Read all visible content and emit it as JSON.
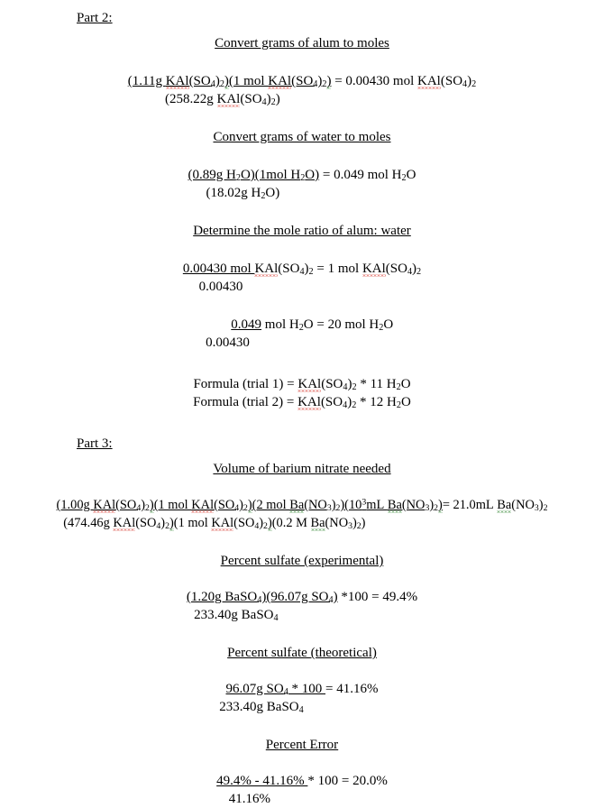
{
  "document": {
    "type": "chemistry-lab-calculations",
    "parts": [
      {
        "label": "Part 2:",
        "sections": [
          {
            "heading": "Convert grams of alum to moles",
            "numerator": "(1.11g KAl(SO4)2)(1 mol KAl(SO4)2)",
            "result": " = 0.00430 mol KAl(SO4)2",
            "denominator": "(258.22g KAl(SO4)2)"
          },
          {
            "heading": "Convert grams of water to moles",
            "numerator": "(0.89g H2O)(1mol H2O)",
            "result": " = 0.049 mol H2O",
            "denominator": "(18.02g H2O)"
          },
          {
            "heading": "Determine the mole ratio of alum: water",
            "numerator": "0.00430 mol ",
            "result": "KAl(SO4)2 = 1 mol KAl(SO4)2",
            "denominator": "0.00430"
          },
          {
            "heading": "",
            "numerator": "0.049",
            "result": " mol H2O = 20 mol H2O",
            "denominator": "0.00430"
          }
        ],
        "formulas": [
          {
            "label": "Formula (trial 1) = ",
            "value": "KAl(SO4)2 * 11 H2O"
          },
          {
            "label": "Formula (trial 2) = ",
            "value": "KAl(SO4)2 * 12 H2O"
          }
        ]
      },
      {
        "label": "Part 3:",
        "sections": [
          {
            "heading": "Volume of barium nitrate needed",
            "numerator": "(1.00g KAl(SO4)2)(1 mol KAl(SO4)2)(2 mol Ba(NO3)2)(10^3mL Ba(NO3)2)",
            "result": "= 21.0mL Ba(NO3)2",
            "denominator": "(474.46g KAl(SO4)2)(1 mol KAl(SO4)2)(0.2 M Ba(NO3)2)"
          },
          {
            "heading": "Percent sulfate (experimental)",
            "numerator": "(1.20g BaSO4)(96.07g SO4)",
            "result": " *100 = 49.4%",
            "denominator": "233.40g BaSO4"
          },
          {
            "heading": "Percent sulfate (theoretical)",
            "numerator": "96.07g SO4 * 100 ",
            "result": "= 41.16%",
            "denominator": "233.40g BaSO4"
          },
          {
            "heading": "Percent Error",
            "numerator": "49.4% - 41.16% ",
            "result": "* 100 = 20.0%",
            "denominator": "41.16%"
          }
        ]
      }
    ],
    "labels": {
      "part2": "Part 2:",
      "part3": "Part 3:",
      "h_convert_alum": "Convert grams of alum to moles",
      "h_convert_water": "Convert grams of water to moles",
      "h_mole_ratio": "Determine the mole ratio of alum: water",
      "h_volume_barium": "Volume of barium nitrate needed",
      "h_pct_sulfate_exp": "Percent sulfate (experimental)",
      "h_pct_sulfate_theo": "Percent sulfate (theoretical)",
      "h_pct_error": "Percent Error",
      "formula_trial1_label": "Formula (trial 1) = ",
      "formula_trial2_label": "Formula (trial 2) = "
    },
    "values": {
      "alum_mass_trial": "1.11g",
      "alum_molar_mass": "258.22g",
      "alum_moles": "0.00430 mol",
      "water_mass": "0.89g",
      "water_molar_mass": "18.02g",
      "water_moles": "0.049 mol",
      "ratio_alum": "1 mol",
      "ratio_water": "20 mol",
      "hydrate_trial1": "11",
      "hydrate_trial2": "12",
      "alum_mass_p3": "1.00g",
      "alum_molar_mass_p3": "474.46g",
      "barium_mol_ratio": "2 mol",
      "ml_conversion": "10",
      "ml_conversion_exp": "3",
      "barium_molarity": "0.2 M",
      "barium_volume": "21.0mL",
      "baso4_mass": "1.20g",
      "so4_molar_mass": "96.07g",
      "baso4_molar_mass": "233.40g",
      "pct_exp": "49.4%",
      "pct_theo": "41.16%",
      "pct_error": "20.0%",
      "multiplier_100": "100"
    },
    "colors": {
      "text": "#000000",
      "background": "#ffffff",
      "spellcheck_red": "#d42a20",
      "spellcheck_green": "#1f7a1f"
    }
  }
}
